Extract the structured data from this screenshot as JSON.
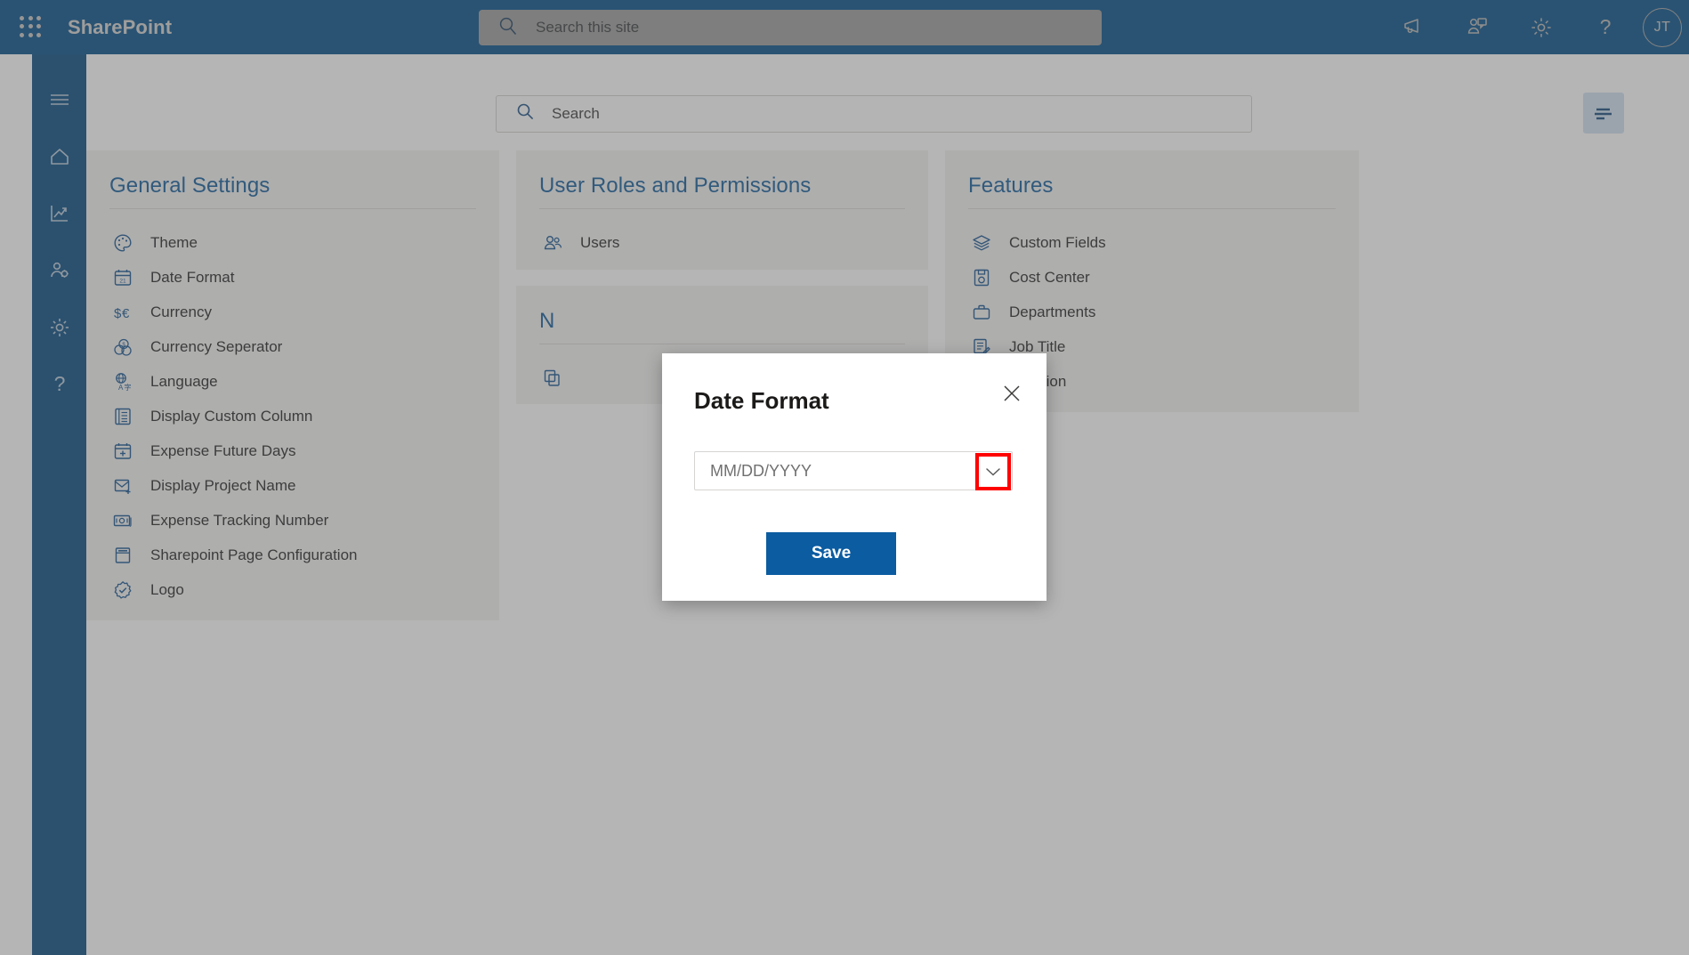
{
  "suite": {
    "brand": "SharePoint",
    "search_placeholder": "Search this site",
    "actions": [
      {
        "name": "megaphone-icon",
        "label": "Announcements"
      },
      {
        "name": "chat-people-icon",
        "label": "Meet"
      },
      {
        "name": "gear-icon",
        "label": "Settings"
      },
      {
        "name": "help-icon",
        "label": "Help"
      }
    ],
    "avatar_initials": "JT"
  },
  "rail": {
    "items": [
      {
        "name": "hamburger-icon",
        "label": "Menu"
      },
      {
        "name": "home-icon",
        "label": "Home"
      },
      {
        "name": "analytics-icon",
        "label": "Reports"
      },
      {
        "name": "user-settings-icon",
        "label": "User Settings"
      },
      {
        "name": "gear-icon",
        "label": "Settings"
      },
      {
        "name": "help-icon",
        "label": "Help"
      }
    ]
  },
  "toolbar": {
    "search_placeholder": "Search",
    "filter_label": "Filter"
  },
  "cards": {
    "general": {
      "title": "General Settings",
      "items": [
        {
          "label": "Theme",
          "icon": "palette-icon"
        },
        {
          "label": "Date Format",
          "icon": "calendar-icon"
        },
        {
          "label": "Currency",
          "icon": "currency-icon"
        },
        {
          "label": "Currency Seperator",
          "icon": "coins-icon"
        },
        {
          "label": "Language",
          "icon": "language-icon"
        },
        {
          "label": "Display Custom Column",
          "icon": "list-icon"
        },
        {
          "label": "Expense Future Days",
          "icon": "calendar-add-icon"
        },
        {
          "label": "Display Project Name",
          "icon": "mail-add-icon"
        },
        {
          "label": "Expense Tracking Number",
          "icon": "banknote-icon"
        },
        {
          "label": "Sharepoint Page Configuration",
          "icon": "page-icon"
        },
        {
          "label": "Logo",
          "icon": "badge-check-icon"
        }
      ]
    },
    "roles": {
      "title": "User Roles and Permissions",
      "items": [
        {
          "label": "Users",
          "icon": "people-icon"
        }
      ]
    },
    "notifications": {
      "title": "N",
      "items": [
        {
          "label": "",
          "icon": "copy-icon"
        }
      ]
    },
    "features": {
      "title": "Features",
      "items": [
        {
          "label": "Custom Fields",
          "icon": "layers-icon"
        },
        {
          "label": "Cost Center",
          "icon": "cost-center-icon"
        },
        {
          "label": "Departments",
          "icon": "briefcase-icon"
        },
        {
          "label": "Job Title",
          "icon": "document-edit-icon"
        },
        {
          "label": "Location",
          "icon": "suitcase-icon"
        }
      ]
    }
  },
  "modal": {
    "title": "Date Format",
    "close_label": "Close",
    "select_value": "MM/DD/YYYY",
    "save_label": "Save",
    "highlight_color": "#ff0000"
  },
  "colors": {
    "suite_bar": "#034e87",
    "rail": "#044a80",
    "card_bg": "#f3f2f1",
    "card_title": "#0f5998",
    "primary_button": "#0b5ca1"
  }
}
